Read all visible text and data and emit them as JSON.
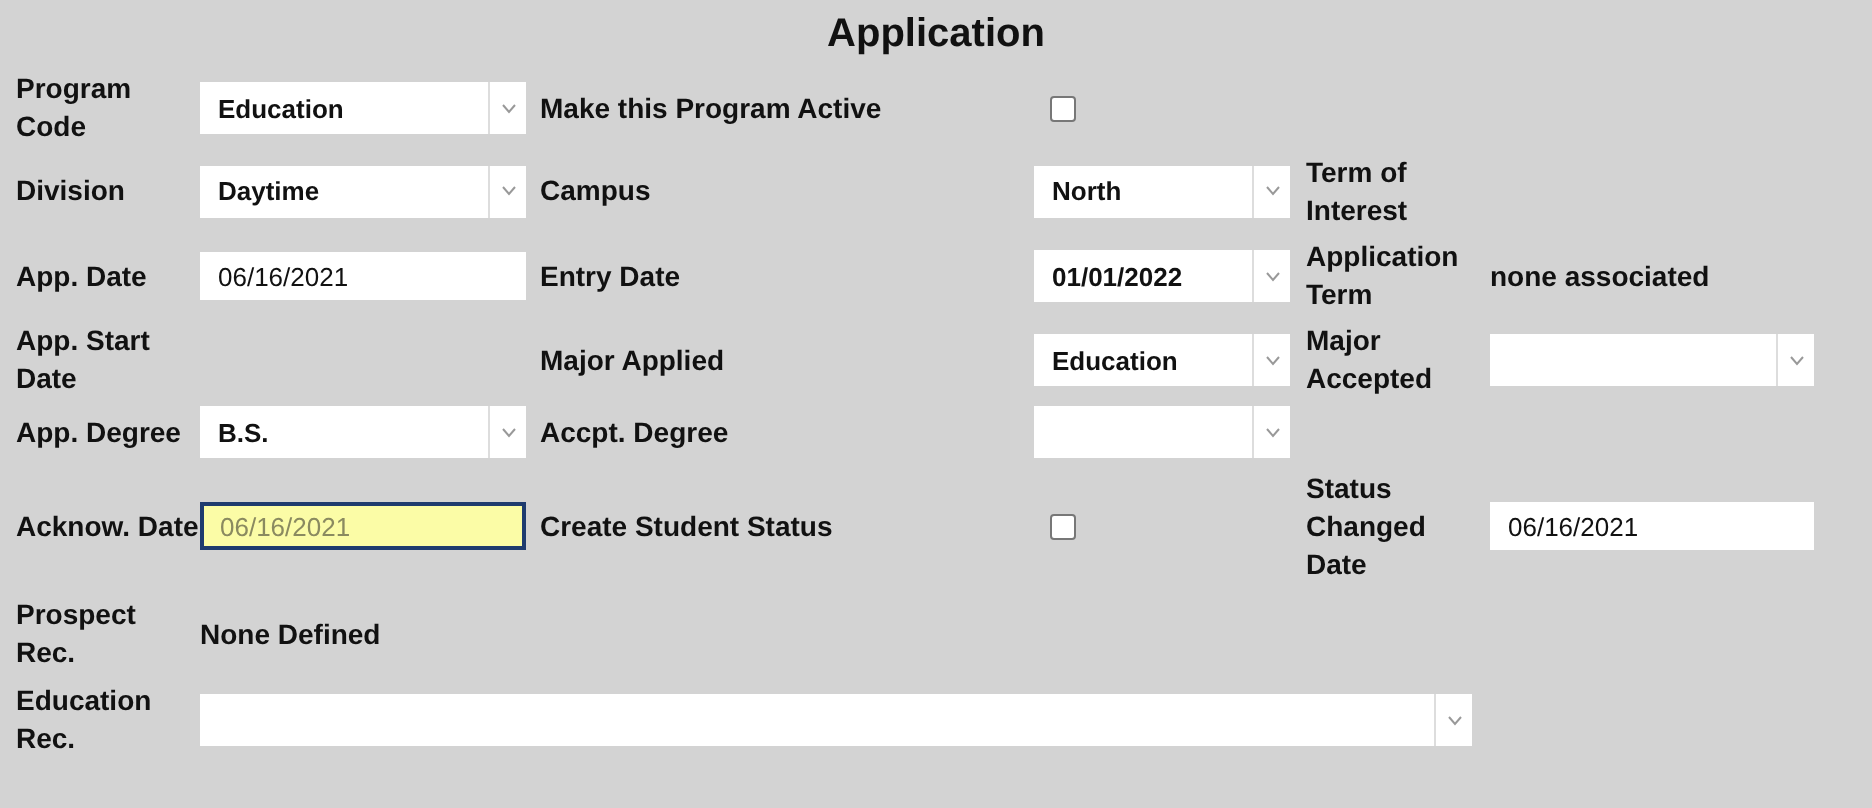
{
  "title": "Application",
  "rows": [
    {
      "left": {
        "label": "Program Code",
        "field": {
          "kind": "dropdown",
          "value": "Education"
        }
      },
      "middle": {
        "label": "Make this Program Active",
        "field": {
          "kind": "checkbox",
          "checked": false
        }
      }
    },
    {
      "left": {
        "label": "Division",
        "field": {
          "kind": "dropdown",
          "value": "Daytime"
        }
      },
      "middle": {
        "label": "Campus",
        "field": {
          "kind": "dropdown",
          "value": "North"
        }
      },
      "right": {
        "label": "Term of Interest"
      }
    },
    {
      "left": {
        "label": "App. Date",
        "field": {
          "kind": "input",
          "value": "06/16/2021",
          "focused": false
        }
      },
      "middle": {
        "label": "Entry Date",
        "field": {
          "kind": "dropdown",
          "value": "01/01/2022"
        }
      },
      "right": {
        "label": "Application Term",
        "field": {
          "kind": "text",
          "value": "none associated"
        }
      }
    },
    {
      "left": {
        "label": "App. Start Date"
      },
      "middle": {
        "label": "Major Applied",
        "field": {
          "kind": "dropdown",
          "value": "Education"
        }
      },
      "right": {
        "label": "Major Accepted",
        "field": {
          "kind": "dropdown"
        }
      }
    },
    {
      "left": {
        "label": "App. Degree",
        "field": {
          "kind": "dropdown",
          "value": "B.S."
        }
      },
      "middle": {
        "label": "Accpt. Degree",
        "field": {
          "kind": "dropdown"
        }
      }
    },
    {
      "left": {
        "label": "Acknow. Date",
        "field": {
          "kind": "input",
          "value": "06/16/2021",
          "focused": true
        }
      },
      "middle": {
        "label": "Create Student Status",
        "field": {
          "kind": "checkbox",
          "checked": false
        }
      },
      "right": {
        "label": "Status Changed Date",
        "field": {
          "kind": "input",
          "value": "06/16/2021",
          "focused": false
        }
      }
    },
    {
      "left": {
        "label": "Prospect Rec.",
        "field": {
          "kind": "text",
          "value": "None Defined"
        }
      }
    },
    {
      "left": {
        "label": "Education Rec.",
        "field": {
          "kind": "dropdown"
        }
      }
    }
  ]
}
